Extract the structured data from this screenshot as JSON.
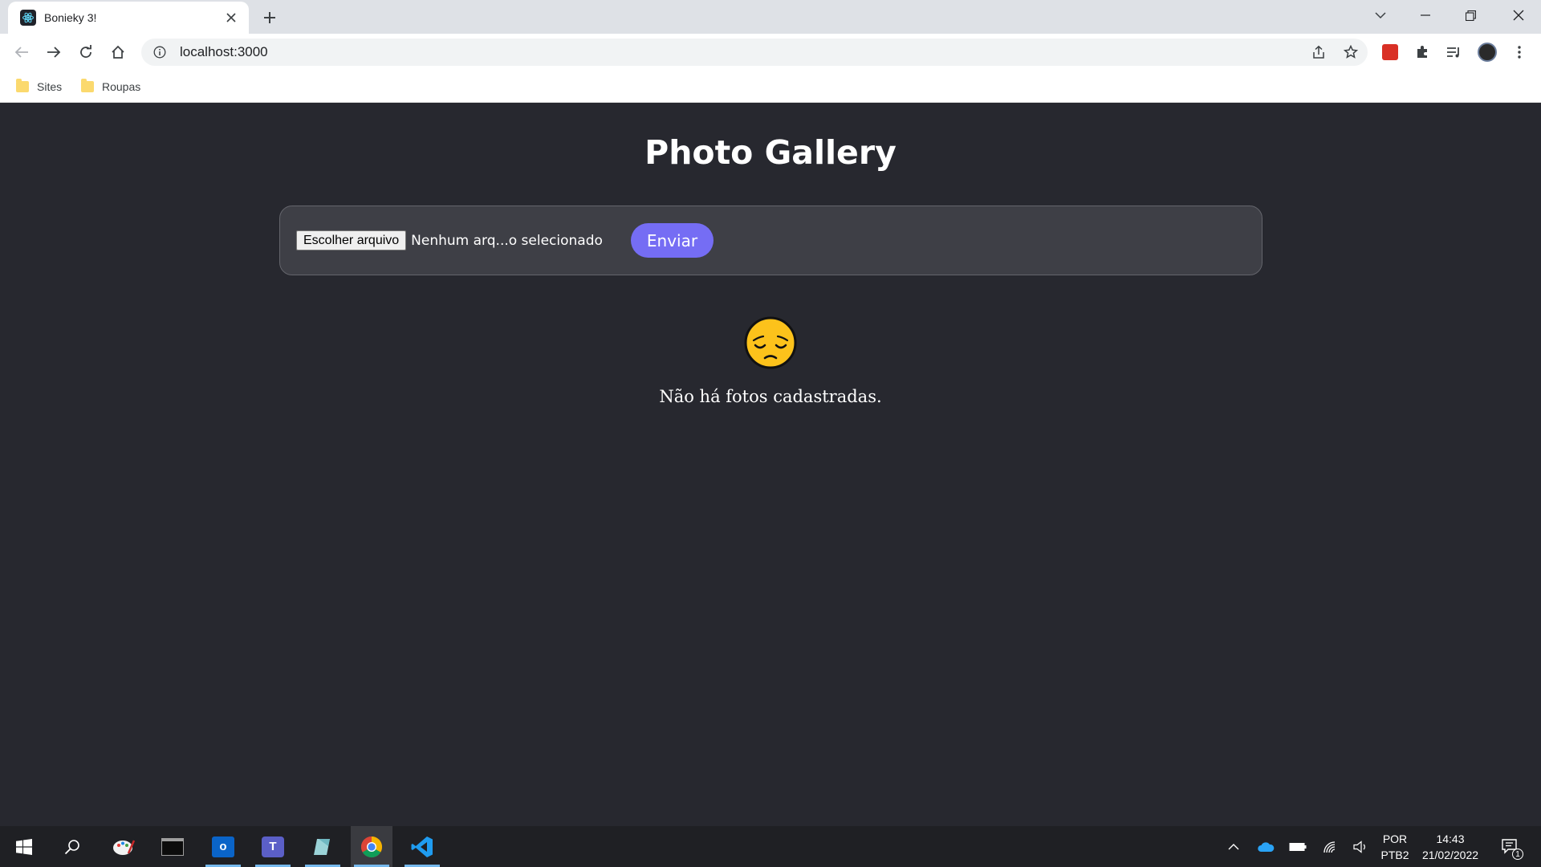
{
  "browser": {
    "tab": {
      "title": "Bonieky 3!"
    },
    "address_bar": {
      "url": "localhost:3000"
    },
    "bookmarks": [
      {
        "label": "Sites"
      },
      {
        "label": "Roupas"
      }
    ]
  },
  "page": {
    "title": "Photo Gallery",
    "upload_form": {
      "file_button_label": "Escolher arquivo",
      "file_status": "Nenhum arq...o selecionado",
      "submit_label": "Enviar"
    },
    "empty_state": {
      "icon": "pensive-face-emoji",
      "message": "Não há fotos cadastradas."
    }
  },
  "taskbar": {
    "apps": [
      {
        "name": "start-icon"
      },
      {
        "name": "search-icon"
      },
      {
        "name": "paint-icon"
      },
      {
        "name": "terminal-icon"
      },
      {
        "name": "outlook-icon"
      },
      {
        "name": "teams-icon"
      },
      {
        "name": "notes-icon"
      },
      {
        "name": "chrome-icon"
      },
      {
        "name": "vscode-icon"
      }
    ],
    "tray": {
      "language_line1": "POR",
      "language_line2": "PTB2",
      "time": "14:43",
      "date": "21/02/2022",
      "notification_count": "1"
    }
  },
  "colors": {
    "page_background": "#27282f",
    "form_background": "#3e3f46",
    "accent_button": "#756df4"
  }
}
